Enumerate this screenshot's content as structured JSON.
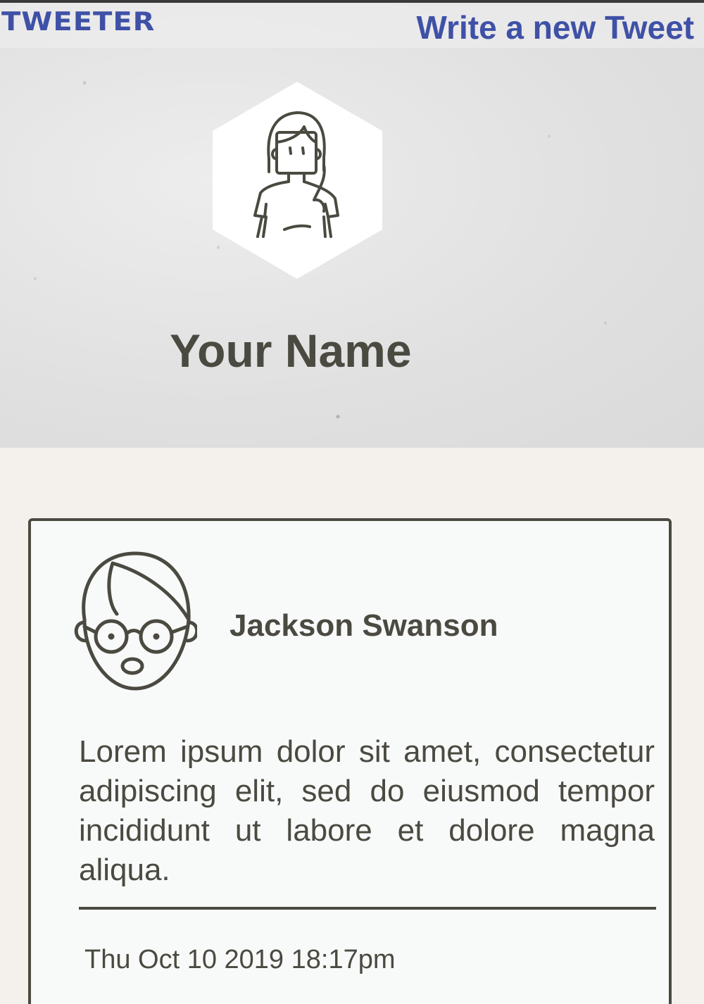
{
  "nav": {
    "brand": "TWEETER",
    "new_tweet_link": "Write a new Tweet"
  },
  "profile": {
    "name": "Your Name",
    "avatar_icon": "woman-avatar-icon"
  },
  "tweet": {
    "author": "Jackson Swanson",
    "avatar_icon": "man-with-glasses-avatar-icon",
    "content": "Lorem ipsum dolor sit amet, consectetur adipiscing elit, sed do eiusmod tempor incididunt ut labore et dolore magna aliqua.",
    "timestamp": "Thu Oct 10 2019 18:17pm"
  },
  "colors": {
    "accent": "#3f51a6",
    "text": "#4a4a41",
    "page_background": "#f4f1ed",
    "card_background": "#f8f9f9"
  }
}
